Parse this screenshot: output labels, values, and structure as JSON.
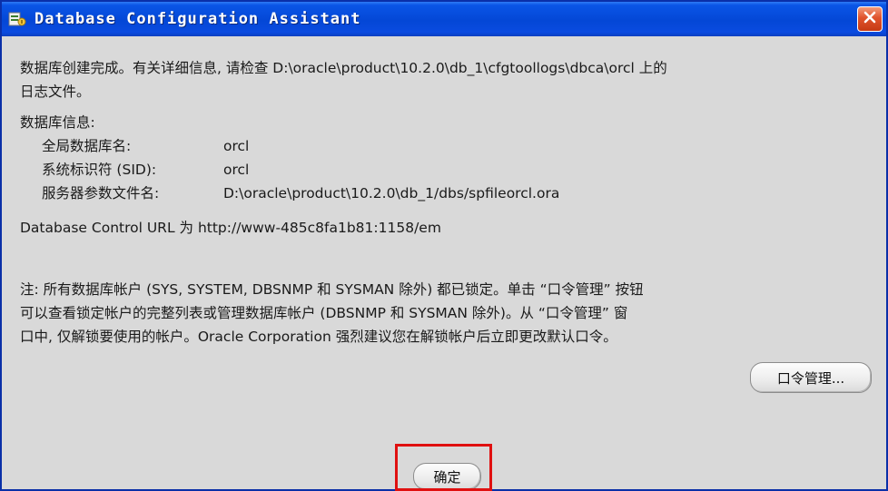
{
  "window": {
    "title": "Database Configuration Assistant",
    "icon": "dbca-app-icon",
    "close_icon": "close-icon"
  },
  "message": {
    "line1": "数据库创建完成。有关详细信息, 请检查 D:\\oracle\\product\\10.2.0\\db_1\\cfgtoollogs\\dbca\\orcl 上的",
    "line2": "日志文件。"
  },
  "db_info": {
    "heading": "数据库信息:",
    "rows": [
      {
        "label": "全局数据库名:",
        "value": "orcl"
      },
      {
        "label": "系统标识符 (SID):",
        "value": "orcl"
      },
      {
        "label": "服务器参数文件名:",
        "value": "D:\\oracle\\product\\10.2.0\\db_1/dbs/spfileorcl.ora"
      }
    ]
  },
  "db_control": "Database Control URL 为 http://www-485c8fa1b81:1158/em",
  "note": {
    "line1": "注: 所有数据库帐户 (SYS, SYSTEM, DBSNMP 和 SYSMAN 除外) 都已锁定。单击 “口令管理” 按钮",
    "line2": "可以查看锁定帐户的完整列表或管理数据库帐户 (DBSNMP 和 SYSMAN 除外)。从 “口令管理” 窗",
    "line3": "口中, 仅解锁要使用的帐户。Oracle Corporation 强烈建议您在解锁帐户后立即更改默认口令。"
  },
  "buttons": {
    "password_management": "口令管理...",
    "ok": "确定"
  },
  "colors": {
    "titlebar": "#0447d6",
    "dialog_bg": "#d9d9d9",
    "highlight": "#e01010"
  }
}
